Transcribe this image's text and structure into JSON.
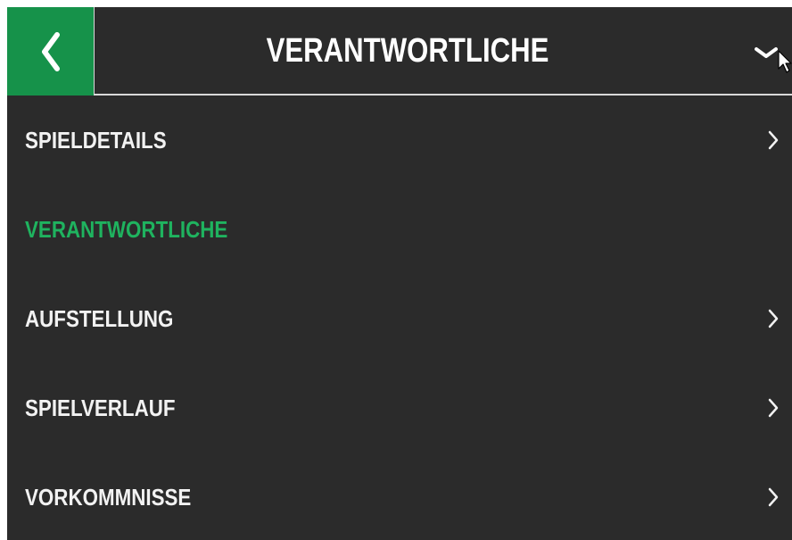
{
  "header": {
    "back_icon": "chevron-left-icon",
    "title": "VERANTWORTLICHE",
    "dropdown_icon": "chevron-down-icon"
  },
  "menu": {
    "items": [
      {
        "label": "SPIELDETAILS",
        "active": false,
        "icon": "chevron-right-icon"
      },
      {
        "label": "VERANTWORTLICHE",
        "active": true
      },
      {
        "label": "AUFSTELLUNG",
        "active": false,
        "icon": "chevron-right-icon"
      },
      {
        "label": "SPIELVERLAUF",
        "active": false,
        "icon": "chevron-right-icon"
      },
      {
        "label": "VORKOMMNISSE",
        "active": false,
        "icon": "chevron-right-icon"
      }
    ]
  },
  "colors": {
    "background": "#2b2b2b",
    "accent": "#16924a",
    "active_text": "#1fb35f",
    "text": "#f2f2f2",
    "divider": "#d9d9d9"
  }
}
